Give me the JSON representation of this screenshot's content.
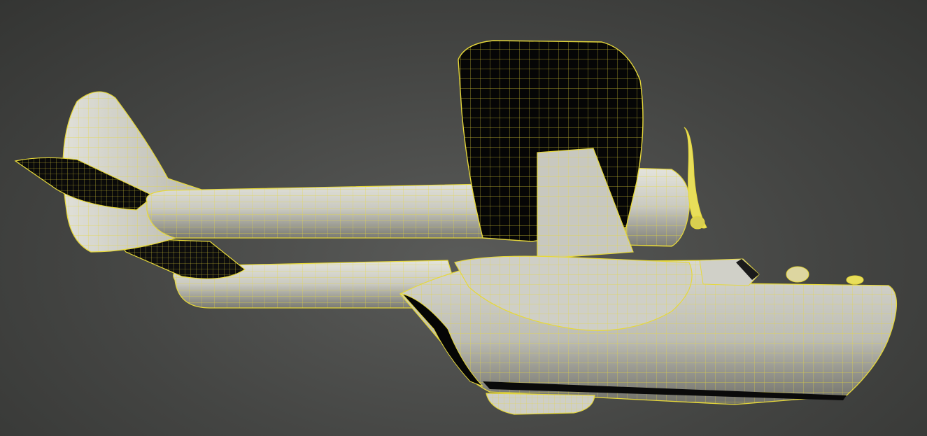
{
  "scene": {
    "viewport": "viewport-3d",
    "render_mode": "shaded-with-wireframe-edges",
    "subject": "seaplane-model",
    "colors": {
      "background": "#454644",
      "wireframe": "#e6d83a",
      "surface_light": "#d4d4cc",
      "surface_mid": "#b3b3aa",
      "surface_dark": "#777770",
      "black_panel": "#070707"
    },
    "parts": [
      "tail-fin",
      "horizontal-stabilizer",
      "rear-boom",
      "lower-boom",
      "main-wing",
      "wing-strut",
      "engine-nacelle",
      "propeller",
      "fuselage-hull",
      "cockpit-canopy",
      "float-pontoon"
    ]
  }
}
